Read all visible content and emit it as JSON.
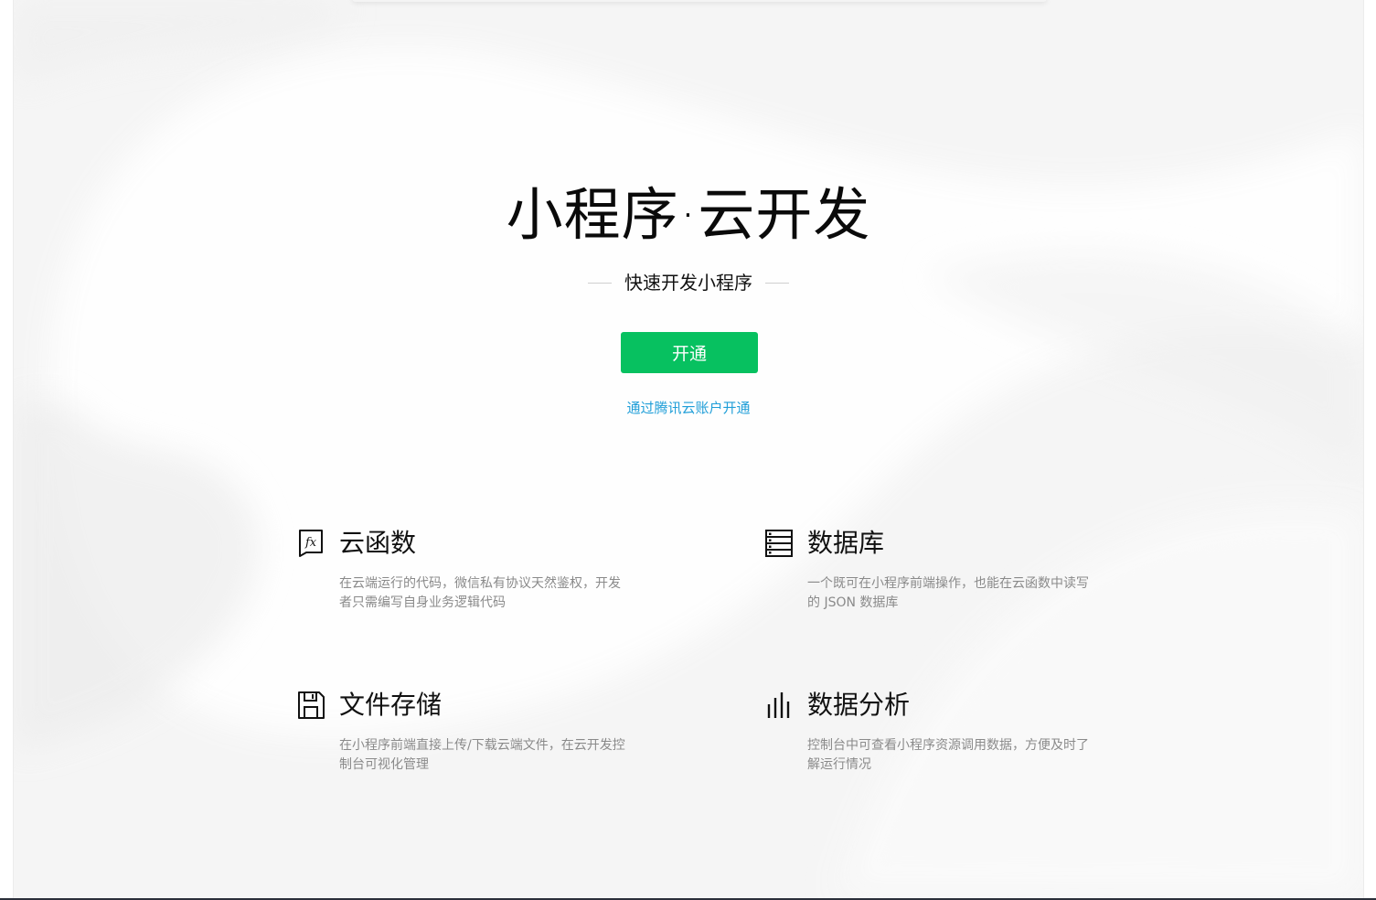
{
  "hero": {
    "title": "小程序·云开发",
    "subtitle": "快速开发小程序",
    "open_button": "开通",
    "tencent_link": "通过腾讯云账户开通"
  },
  "features": [
    {
      "icon": "function-fx-icon",
      "title": "云函数",
      "description": "在云端运行的代码，微信私有协议天然鉴权，开发者只需编写自身业务逻辑代码"
    },
    {
      "icon": "database-icon",
      "title": "数据库",
      "description": "一个既可在小程序前端操作，也能在云函数中读写的 JSON 数据库"
    },
    {
      "icon": "floppy-disk-icon",
      "title": "文件存储",
      "description": "在小程序前端直接上传/下载云端文件，在云开发控制台可视化管理"
    },
    {
      "icon": "bar-chart-icon",
      "title": "数据分析",
      "description": "控制台中可查看小程序资源调用数据，方便及时了解运行情况"
    }
  ],
  "colors": {
    "accent_green": "#07c160",
    "link_blue": "#1f9ed8",
    "background": "#f6f6f6"
  }
}
